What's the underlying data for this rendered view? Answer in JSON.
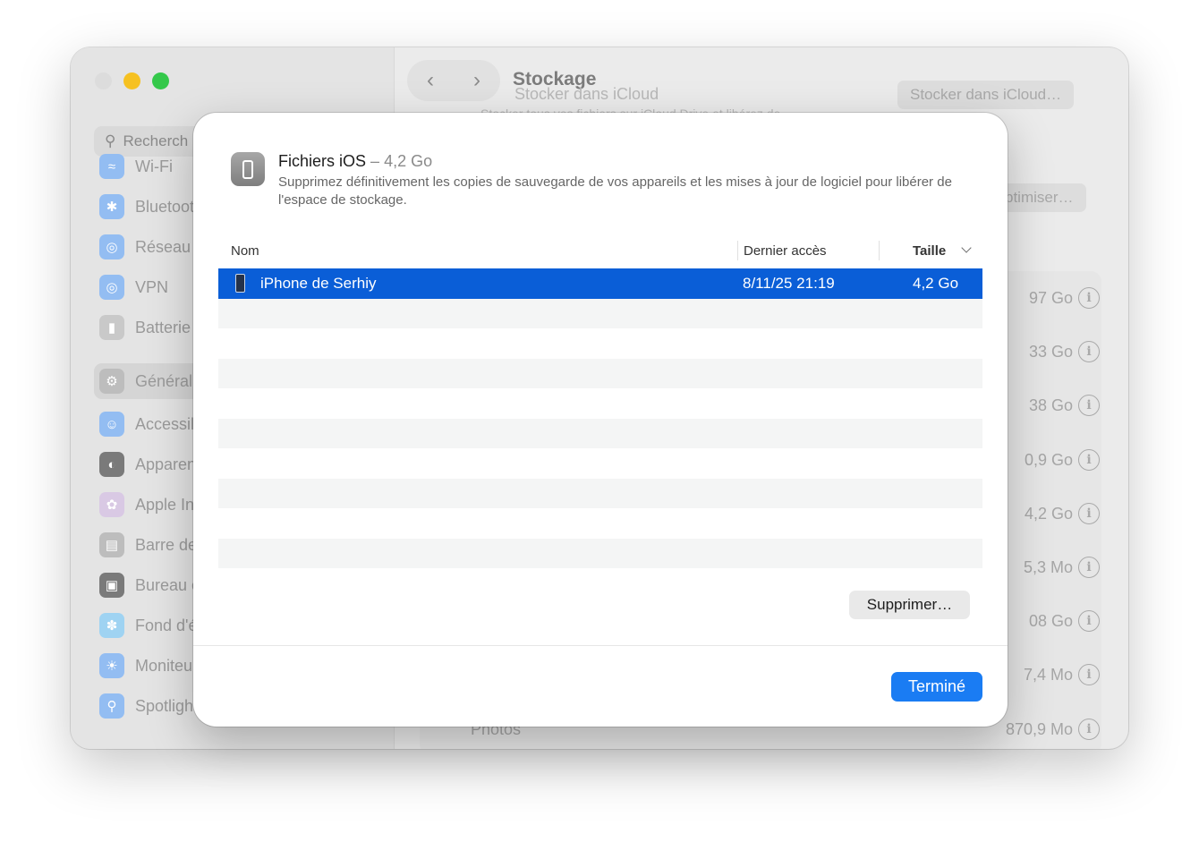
{
  "window": {
    "title": "Stockage",
    "nav": {
      "back_icon": "chevron-left-icon",
      "forward_icon": "chevron-right-icon"
    }
  },
  "sidebar": {
    "search_placeholder": "Recherch",
    "items": [
      {
        "label": "Wi-Fi",
        "icon": "wifi-icon",
        "color": "#2f8cf7"
      },
      {
        "label": "Bluetoot",
        "icon": "bluetooth-icon",
        "color": "#2f8cf7"
      },
      {
        "label": "Réseau",
        "icon": "globe-icon",
        "color": "#2f8cf7"
      },
      {
        "label": "VPN",
        "icon": "vpn-icon",
        "color": "#2f8cf7"
      },
      {
        "label": "Batterie",
        "icon": "battery-icon",
        "color": "#3fb846"
      },
      {
        "label": "Général",
        "icon": "gear-icon",
        "color": "#8e8e93"
      },
      {
        "label": "Accessil",
        "icon": "accessibility-icon",
        "color": "#2f8cf7"
      },
      {
        "label": "Apparen",
        "icon": "appearance-icon",
        "color": "#1c1c1e"
      },
      {
        "label": "Apple In",
        "icon": "apple-intelligence-icon",
        "color": "#d0a8e8"
      },
      {
        "label": "Barre de",
        "icon": "control-center-icon",
        "color": "#8e8e93"
      },
      {
        "label": "Bureau e",
        "icon": "desktop-icon",
        "color": "#1c1c1e"
      },
      {
        "label": "Fond d'é",
        "icon": "wallpaper-icon",
        "color": "#2fb6f0"
      },
      {
        "label": "Moniteu",
        "icon": "screensaver-icon",
        "color": "#2f8cf7"
      },
      {
        "label": "Spotligh",
        "icon": "spotlight-icon",
        "color": "#2f8cf7"
      }
    ]
  },
  "background": {
    "icloud_title": "Stocker dans iCloud",
    "icloud_desc": "Stocker tous vos fichiers sur iCloud Drive et libérez de",
    "icloud_button": "Stocker dans iCloud…",
    "optimize_button": "ptimiser…",
    "sizes": [
      "97 Go",
      "33 Go",
      "38 Go",
      "0,9 Go",
      "4,2 Go",
      "5,3 Mo",
      "08 Go",
      "7,4 Mo",
      "870,9 Mo"
    ],
    "photos_label": "Photos"
  },
  "sheet": {
    "icon": "iphone-icon",
    "title": "Fichiers iOS",
    "title_separator": "–",
    "title_size": "4,2 Go",
    "description": "Supprimez définitivement les copies de sauvegarde de vos appareils et les mises à jour de logiciel pour libérer de l'espace de stockage.",
    "columns": {
      "name": "Nom",
      "last_access": "Dernier accès",
      "size": "Taille"
    },
    "rows": [
      {
        "name": "iPhone de Serhiy",
        "last_access": "8/11/25 21:19",
        "size": "4,2 Go"
      }
    ],
    "delete_button": "Supprimer…",
    "done_button": "Terminé",
    "accent_color": "#0a5ed7"
  }
}
